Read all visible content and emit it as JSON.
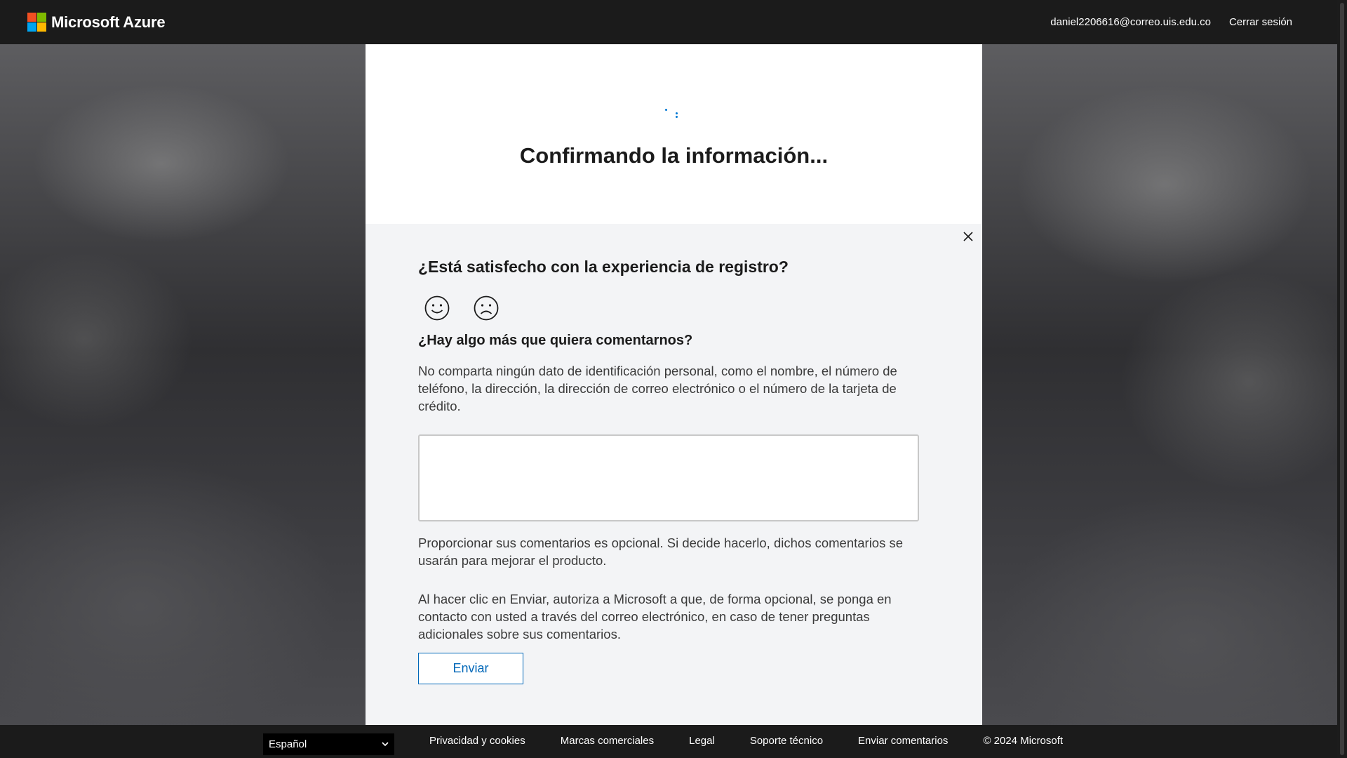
{
  "header": {
    "brand": "Microsoft Azure",
    "email": "daniel2206616@correo.uis.edu.co",
    "signout": "Cerrar sesión"
  },
  "card": {
    "title": "Confirmando la información..."
  },
  "feedback": {
    "question": "¿Está satisfecho con la experiencia de registro?",
    "more_question": "¿Hay algo más que quiera comentarnos?",
    "privacy_note": "No comparta ningún dato de identificación personal, como el nombre, el número de teléfono, la dirección, la dirección de correo electrónico o el número de la tarjeta de crédito.",
    "comment_value": "",
    "optional_note": "Proporcionar sus comentarios es opcional. Si decide hacerlo, dichos comentarios se usarán para mejorar el producto.",
    "consent_note": "Al hacer clic en Enviar, autoriza a Microsoft a que, de forma opcional, se ponga en contacto con usted a través del correo electrónico, en caso de tener preguntas adicionales sobre sus comentarios.",
    "send_label": "Enviar",
    "icons": [
      "close-icon",
      "smile-icon",
      "frown-icon"
    ]
  },
  "footer": {
    "language": "Español",
    "links": [
      "Privacidad y cookies",
      "Marcas comerciales",
      "Legal",
      "Soporte técnico",
      "Enviar comentarios"
    ],
    "copyright": "© 2024 Microsoft"
  },
  "colors": {
    "accent": "#0067b8",
    "topbar": "#1b1b1b",
    "feedback_bg": "#f3f4f6"
  }
}
